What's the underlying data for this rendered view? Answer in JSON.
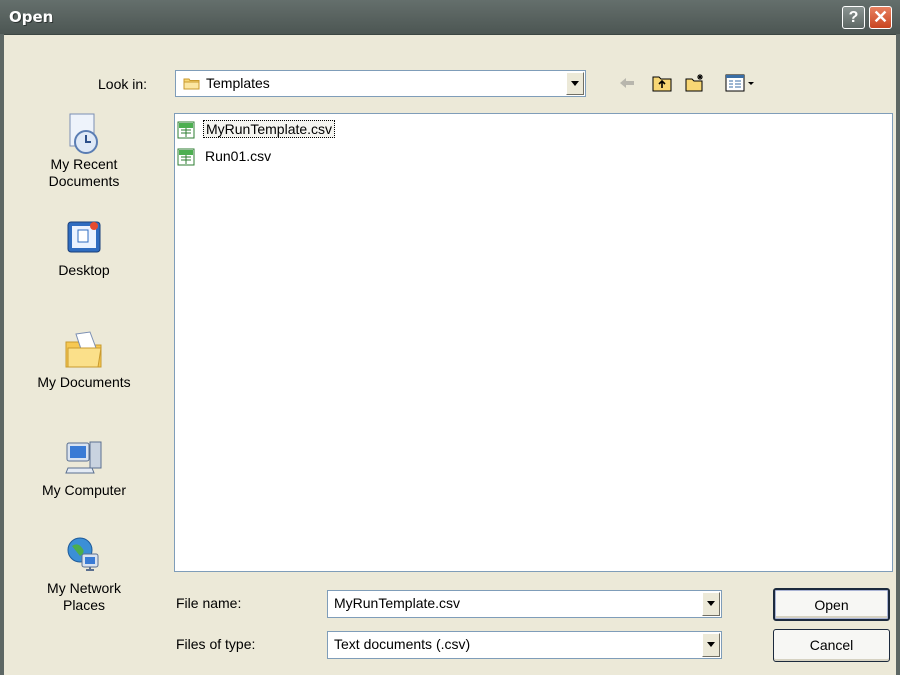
{
  "window": {
    "title": "Open",
    "help_glyph": "?",
    "close_glyph": "✕"
  },
  "look_in": {
    "label": "Look in:",
    "value": "Templates"
  },
  "toolbar": {
    "back_icon": "back-arrow-icon",
    "up_icon": "up-folder-icon",
    "new_folder_icon": "new-folder-icon",
    "view_icon": "view-menu-icon"
  },
  "places": [
    {
      "label": "My Recent Documents",
      "icon": "recent-documents-icon"
    },
    {
      "label": "Desktop",
      "icon": "desktop-icon"
    },
    {
      "label": "My Documents",
      "icon": "my-documents-icon"
    },
    {
      "label": "My Computer",
      "icon": "my-computer-icon"
    },
    {
      "label": "My Network Places",
      "icon": "network-places-icon"
    }
  ],
  "files": [
    {
      "name": "MyRunTemplate.csv",
      "selected": true
    },
    {
      "name": "Run01.csv",
      "selected": false
    }
  ],
  "file_name": {
    "label": "File name:",
    "value": "MyRunTemplate.csv"
  },
  "file_type": {
    "label": "Files of type:",
    "value": "Text documents (.csv)"
  },
  "buttons": {
    "open": "Open",
    "cancel": "Cancel"
  },
  "colors": {
    "titlebar": "#5b6562",
    "close": "#c94520",
    "face": "#ece9d8",
    "border": "#7f9db9"
  }
}
